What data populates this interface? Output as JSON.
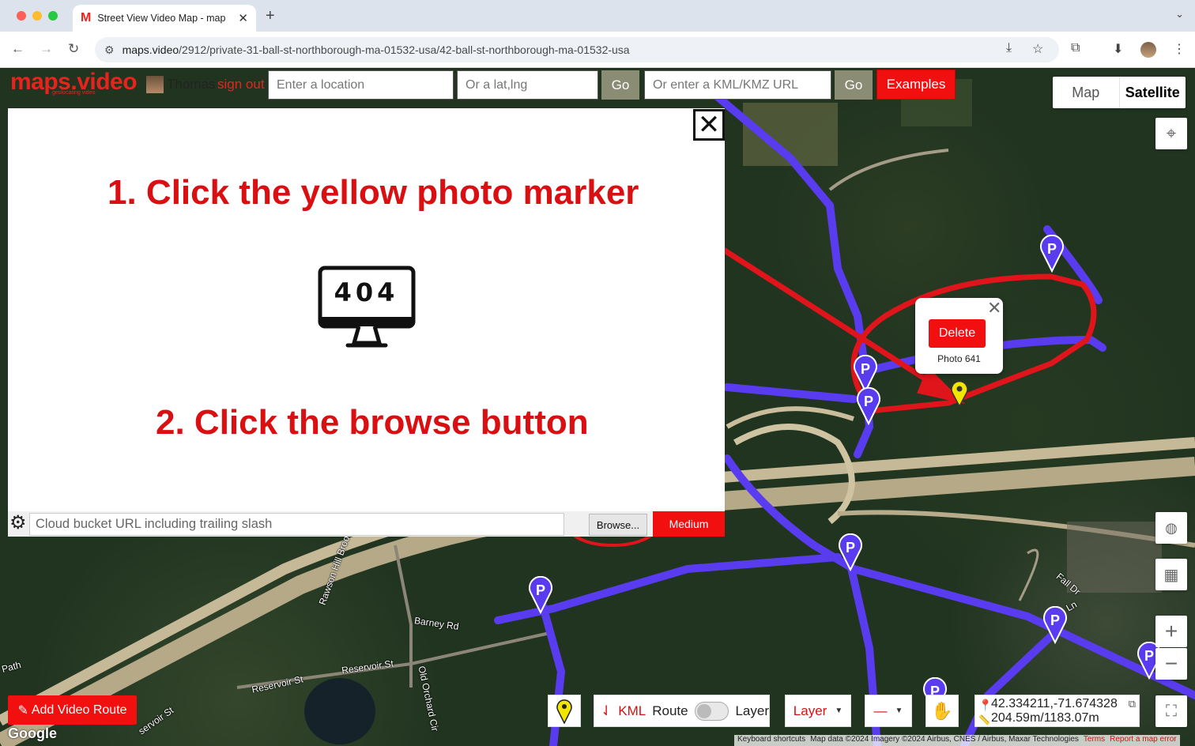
{
  "browser": {
    "tab_title": "Street View Video Map - map",
    "tab_favicon": "M",
    "url_domain": "maps.video",
    "url_path": "/2912/private-31-ball-st-northborough-ma-01532-usa/42-ball-st-northborough-ma-01532-usa"
  },
  "header": {
    "logo": "maps.video",
    "logo_sub": "geolocating video",
    "user_name": "Thomas",
    "sign_out": "sign out",
    "location_placeholder": "Enter a location",
    "latlng_placeholder": "Or a lat,lng",
    "go_label": "Go",
    "kml_placeholder": "Or enter a KML/KMZ URL",
    "go2_label": "Go",
    "examples_label": "Examples"
  },
  "map_type": {
    "map": "Map",
    "satellite": "Satellite"
  },
  "panel": {
    "step1": "1. Click the yellow photo marker",
    "step2": "2. Click the browse button",
    "error_code": "404",
    "bucket_placeholder": "Cloud bucket URL including trailing slash",
    "browse_label": "Browse...",
    "quality_label": "Medium"
  },
  "popup": {
    "delete_label": "Delete",
    "photo_label": "Photo 641"
  },
  "bottom": {
    "add_route": "Add Video Route",
    "kml": "KML",
    "route": "Route",
    "layer": "Layer",
    "layer_dd": "Layer",
    "dash_dd": "—",
    "coords": "42.334211,-71.674328",
    "distance": "204.59m/1183.07m"
  },
  "road_labels": [
    "Barney Rd",
    "Reservoir St",
    "Reservoir St",
    "Old Orchard Cir",
    "Rawson Hill Brook",
    "Fall Dr",
    "Ln",
    "Path",
    "servoir St"
  ],
  "attribution": {
    "shortcuts": "Keyboard shortcuts",
    "data": "Map data ©2024 Imagery ©2024 Airbus, CNES / Airbus, Maxar Technologies",
    "terms": "Terms",
    "report": "Report a map error"
  },
  "google_label": "Google",
  "colors": {
    "brand_red": "#f10f0f",
    "route_blue": "#5a3cf0",
    "annotation_red": "#d90f12",
    "marker_yellow": "#f2e600"
  }
}
